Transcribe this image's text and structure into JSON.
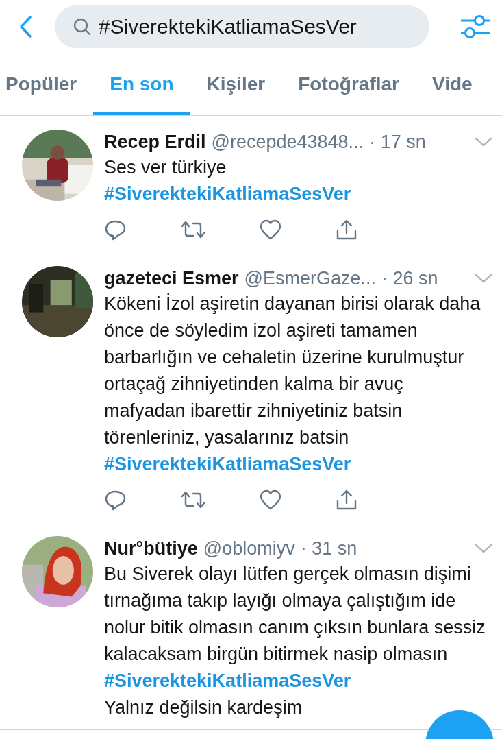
{
  "search": {
    "value": "#SiverektekiKatliamaSesVer"
  },
  "tabs": [
    {
      "label": "Popüler",
      "selected": false
    },
    {
      "label": "En son",
      "selected": true
    },
    {
      "label": "Kişiler",
      "selected": false
    },
    {
      "label": "Fotoğraflar",
      "selected": false
    },
    {
      "label": "Vide",
      "selected": false
    }
  ],
  "tweets": [
    {
      "name": "Recep Erdil",
      "handle": "@recepde43848...",
      "time": "· 17 sn",
      "avatar": {
        "kind": "picture"
      },
      "content": [
        {
          "kind": "text",
          "text": "Ses ver türkiye"
        },
        {
          "kind": "hashtag",
          "text": "#SiverektekiKatliamaSesVer"
        }
      ],
      "actions": true
    },
    {
      "name": "gazeteci Esmer",
      "handle": "@EsmerGaze...",
      "time": "· 26 sn",
      "avatar": {
        "kind": "picture"
      },
      "content": [
        {
          "kind": "text",
          "text": "Kökeni İzol aşiretin dayanan birisi olarak daha önce de söyledim izol aşireti tamamen barbarlığın ve cehaletin üzerine kurulmuştur ortaçağ zihniyetinden kalma bir avuç mafyadan ibarettir zihniyetiniz batsin törenleriniz, yasalarınız batsin"
        },
        {
          "kind": "hashtag",
          "text": "#SiverektekiKatliamaSesVer"
        }
      ],
      "actions": true
    },
    {
      "name": "Nur°bütiye",
      "handle": "@oblomiyv",
      "time": "· 31 sn",
      "avatar": {
        "kind": "picture"
      },
      "content": [
        {
          "kind": "text",
          "text": "Bu Siverek olayı lütfen gerçek olmasın dişimi tırnağıma takıp layığı olmaya çalıştığım  ide nolur bitik olmasın canım çıksın bunlara sessiz kalacaksam birgün bitirmek nasip olmasın"
        },
        {
          "kind": "hashtag",
          "text": "#SiverektekiKatliamaSesVer"
        },
        {
          "kind": "text",
          "text": "Yalnız değilsin kardeşim"
        }
      ],
      "actions": false
    }
  ]
}
